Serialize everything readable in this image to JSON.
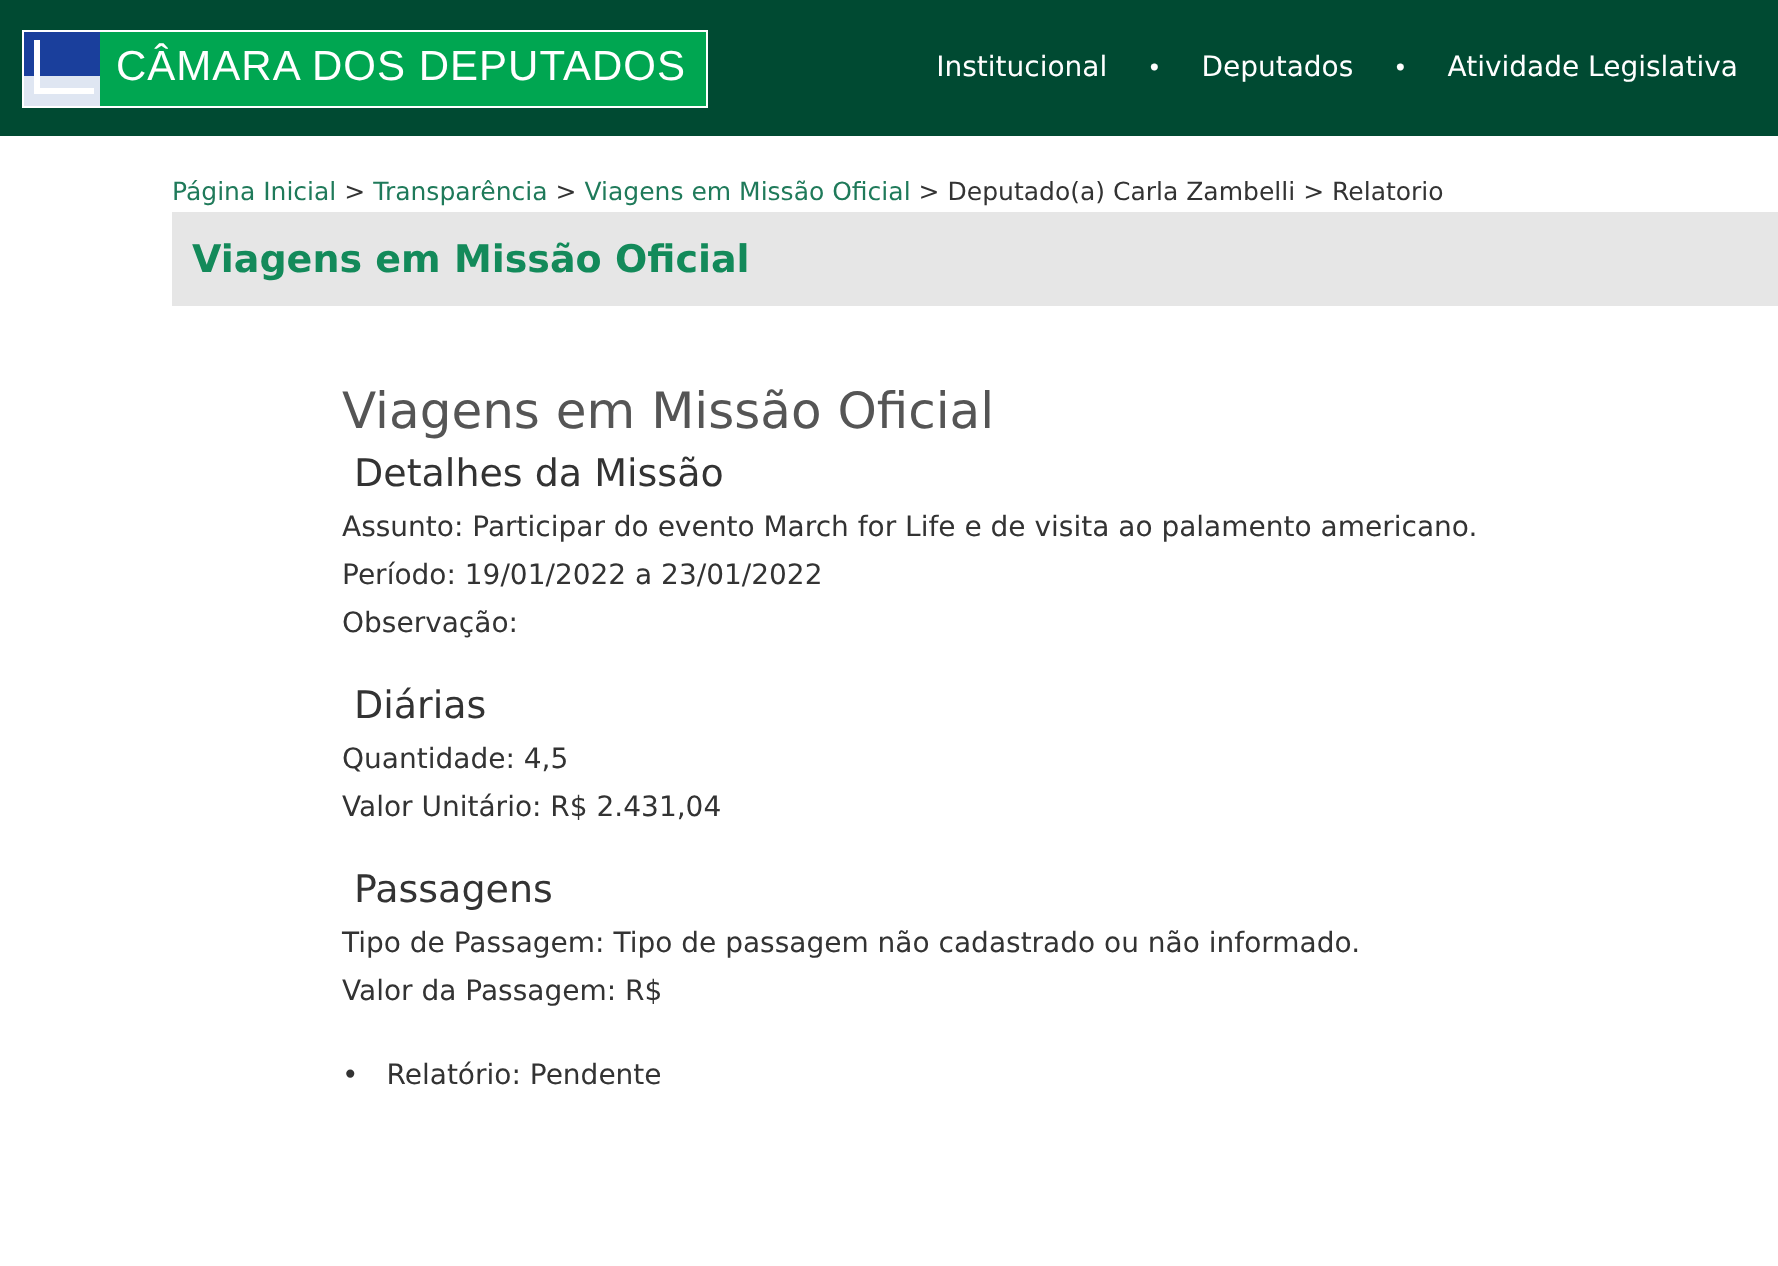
{
  "header": {
    "logo_text": "CÂMARA DOS DEPUTADOS",
    "nav": [
      {
        "label": "Institucional"
      },
      {
        "label": "Deputados"
      },
      {
        "label": "Atividade Legislativa"
      }
    ],
    "separator": "•"
  },
  "breadcrumb": {
    "separator": ">",
    "items": [
      {
        "label": "Página Inicial",
        "kind": "link"
      },
      {
        "label": "Transparência",
        "kind": "link"
      },
      {
        "label": "Viagens em Missão Oficial",
        "kind": "link"
      },
      {
        "label": "Deputado(a) Carla Zambelli",
        "kind": "text"
      },
      {
        "label": "Relatorio",
        "kind": "text"
      }
    ]
  },
  "section_title": "Viagens em Missão Oficial",
  "page_title": "Viagens em Missão Oficial",
  "sections": [
    {
      "heading": "Detalhes da Missão",
      "lines": [
        "Assunto: Participar do evento March for Life e de visita ao palamento americano.",
        "Período: 19/01/2022 a 23/01/2022",
        "Observação:"
      ]
    },
    {
      "heading": "Diárias",
      "lines": [
        "Quantidade: 4,5",
        "Valor Unitário: R$ 2.431,04"
      ]
    },
    {
      "heading": "Passagens",
      "lines": [
        "Tipo de Passagem: Tipo de passagem não cadastrado ou não informado.",
        "Valor da Passagem: R$"
      ]
    }
  ],
  "bullet_marker": "•",
  "bullets": [
    "Relatório: Pendente"
  ]
}
